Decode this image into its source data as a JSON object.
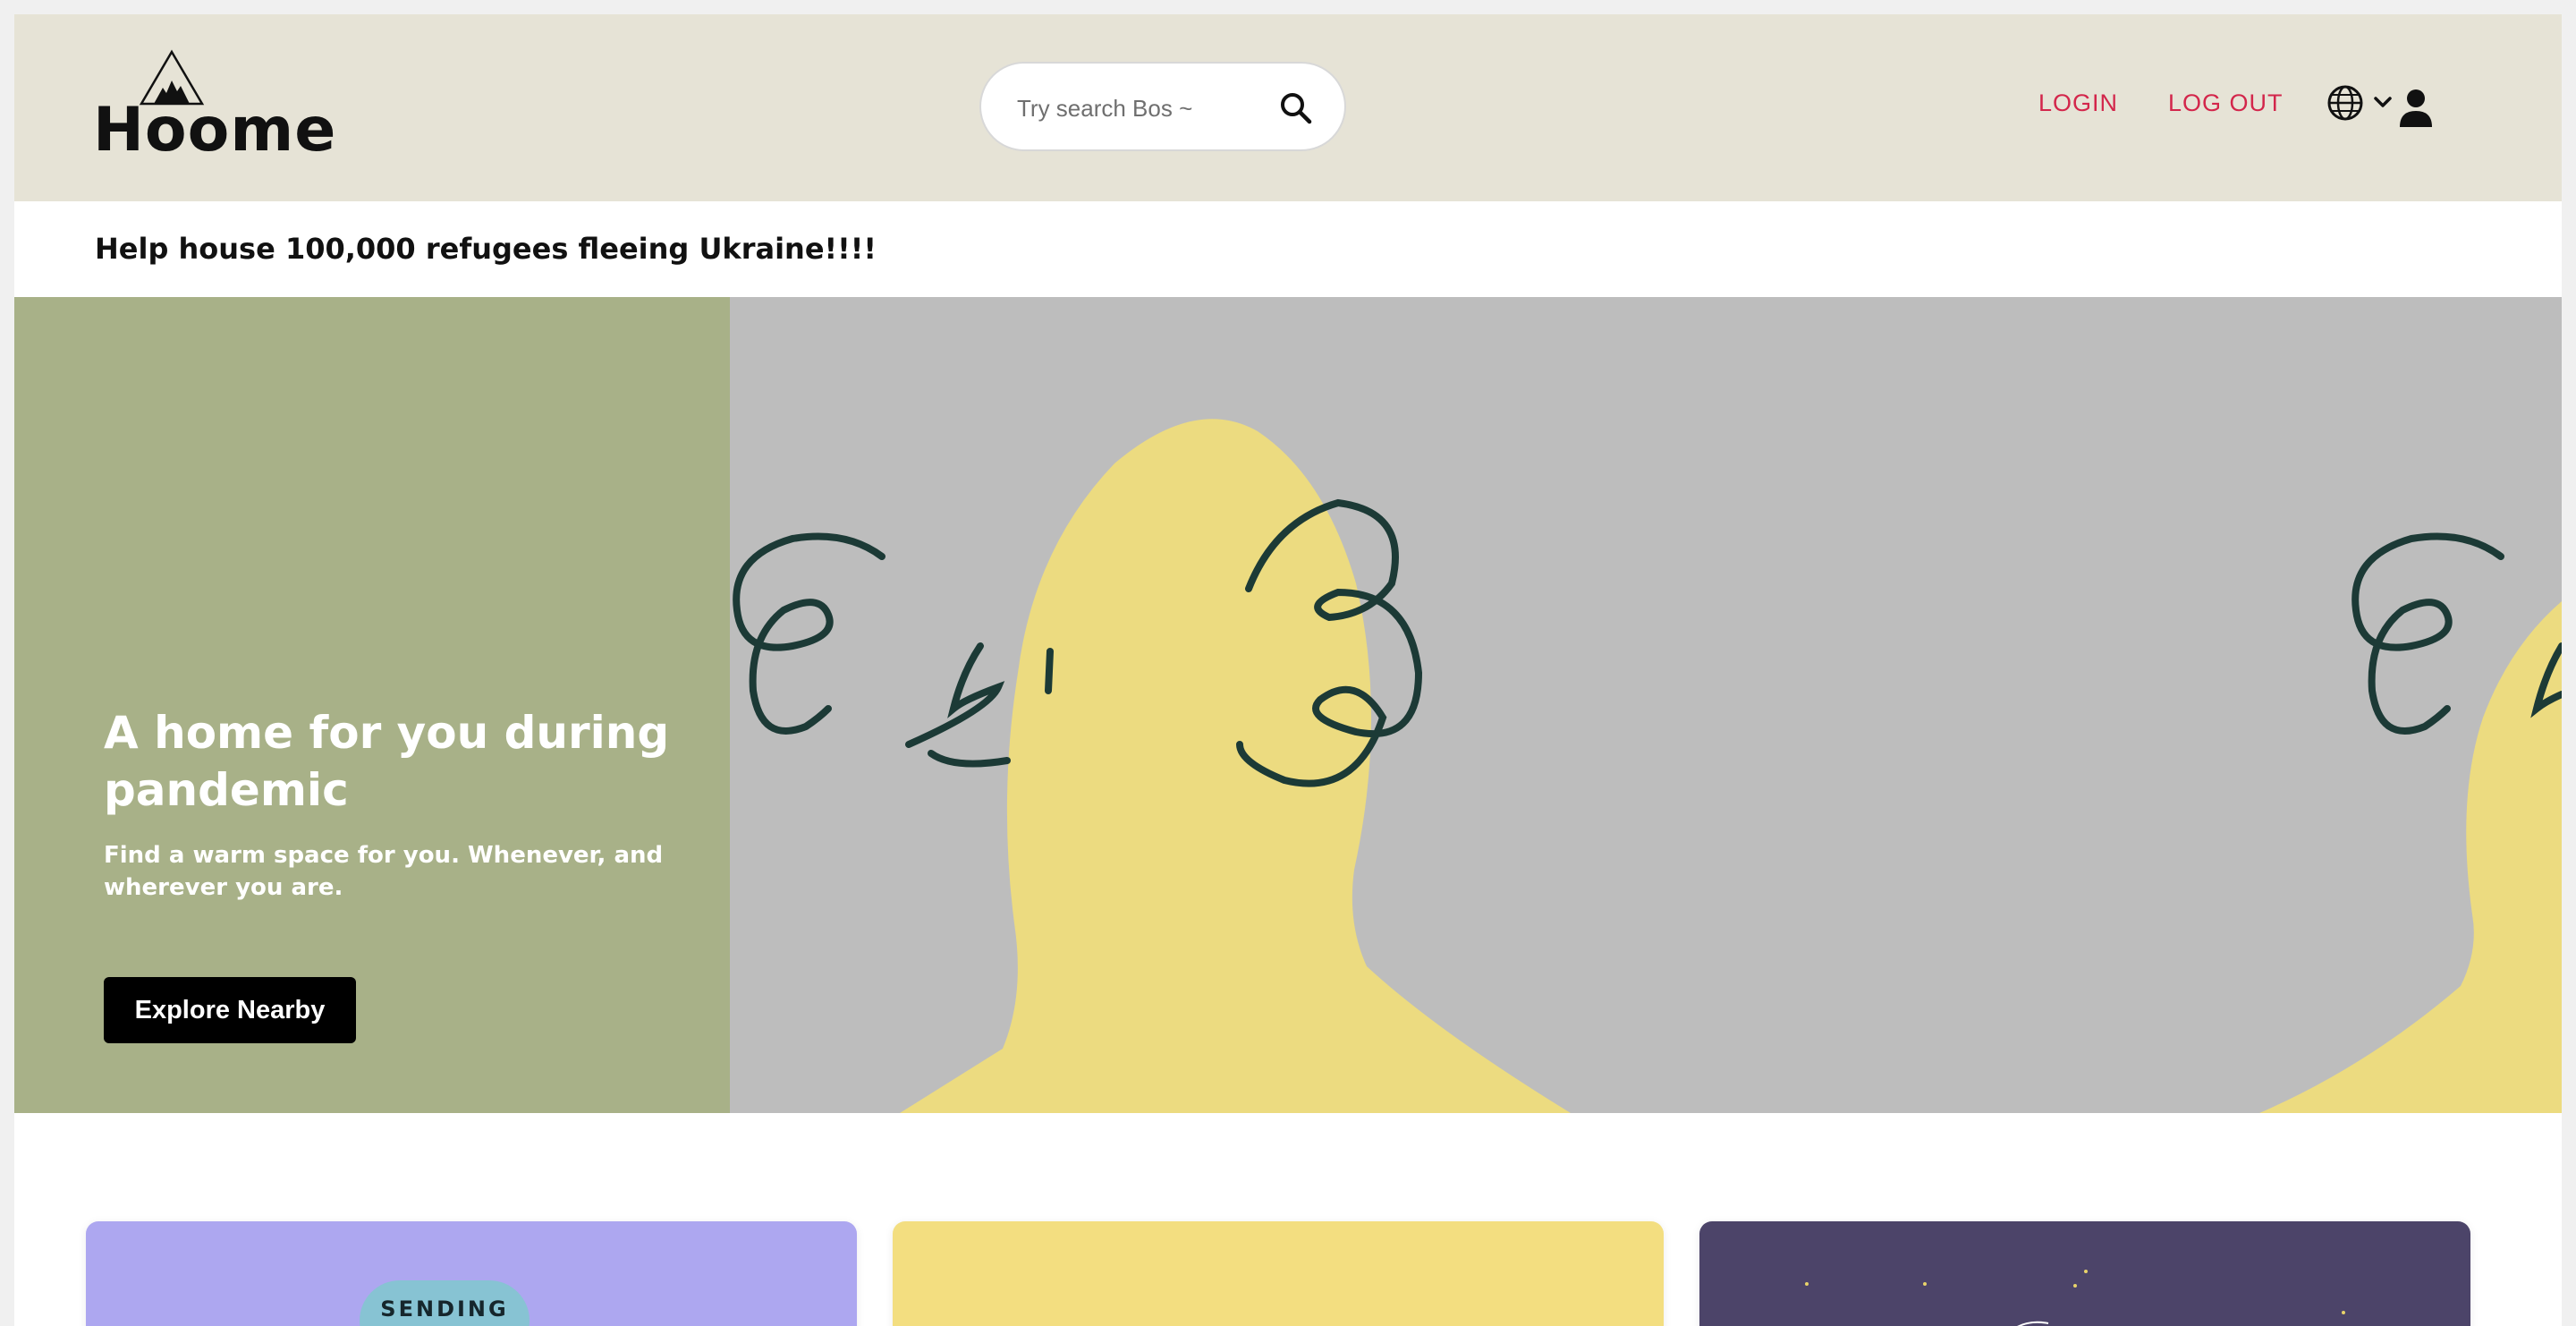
{
  "header": {
    "logo_text": "Hoome",
    "search": {
      "placeholder": "Try search Bos ~"
    },
    "nav": {
      "login": "LOGIN",
      "logout": "LOG OUT"
    },
    "colors": {
      "background": "#e6e3d6",
      "nav_link": "#d3264b"
    }
  },
  "notice": {
    "text": "Help house 100,000 refugees fleeing Ukraine!!!!"
  },
  "hero": {
    "title": "A home for you during pandemic",
    "subtitle": "Find a warm space for you. Whenever, and wherever you are.",
    "button_label": "Explore Nearby",
    "colors": {
      "left_panel": "#a8b188",
      "art_background": "#bdbdbd",
      "figure": "#ecdb80",
      "lines": "#1c3a36"
    }
  },
  "cards": [
    {
      "color": "#ada7f0",
      "badge_text": "SENDING"
    },
    {
      "color": "#f3de80"
    },
    {
      "color": "#4c4469"
    }
  ]
}
